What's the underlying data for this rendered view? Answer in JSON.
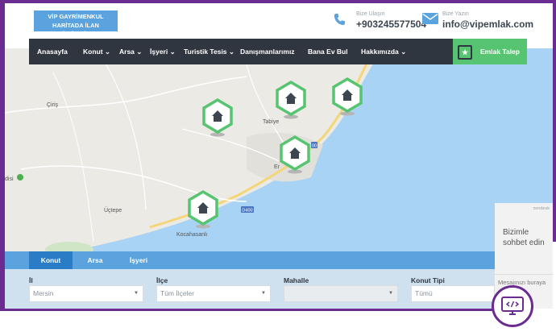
{
  "header": {
    "logo_line1": "VİP GAYRİMENKUL",
    "logo_line2": "HARİTADA İLAN GÖRÜNTÜLE",
    "phone_label": "Bize Ulaşın",
    "phone": "+903245577504",
    "email_label": "Bize Yazın",
    "email": "info@vipemlak.com"
  },
  "nav": {
    "items": [
      "Anasayfa",
      "Konut",
      "Arsa",
      "İşyeri",
      "Turistik Tesis",
      "Danışmanlarımız",
      "Bana Ev Bul",
      "Hakkımızda"
    ],
    "cta": "Emlak Talep"
  },
  "map": {
    "places": [
      "Çiriş",
      "Tabiye",
      "Er",
      "disi",
      "Üçtepe",
      "Kocahasanlı"
    ],
    "road_labels": [
      "D400",
      "00"
    ],
    "markers": 5
  },
  "search": {
    "tabs": [
      "Konut",
      "Arsa",
      "İşyeri"
    ],
    "active_tab": "Konut",
    "fields": [
      {
        "label": "İl",
        "value": "Mersin"
      },
      {
        "label": "İlçe",
        "value": "Tüm İlçeler"
      },
      {
        "label": "Mahalle",
        "value": ""
      },
      {
        "label": "Konut Tipi",
        "value": "Tümü"
      }
    ]
  },
  "chat": {
    "brand": "zendesk",
    "title_line1": "Bizimle",
    "title_line2": "sohbet edin",
    "placeholder": "Mesajınızı buraya"
  },
  "colors": {
    "accent_blue": "#5aa3de",
    "nav_dark": "#2f3640",
    "green": "#56c470",
    "frame_purple": "#6b2c91",
    "sea": "#a9d3f5"
  }
}
